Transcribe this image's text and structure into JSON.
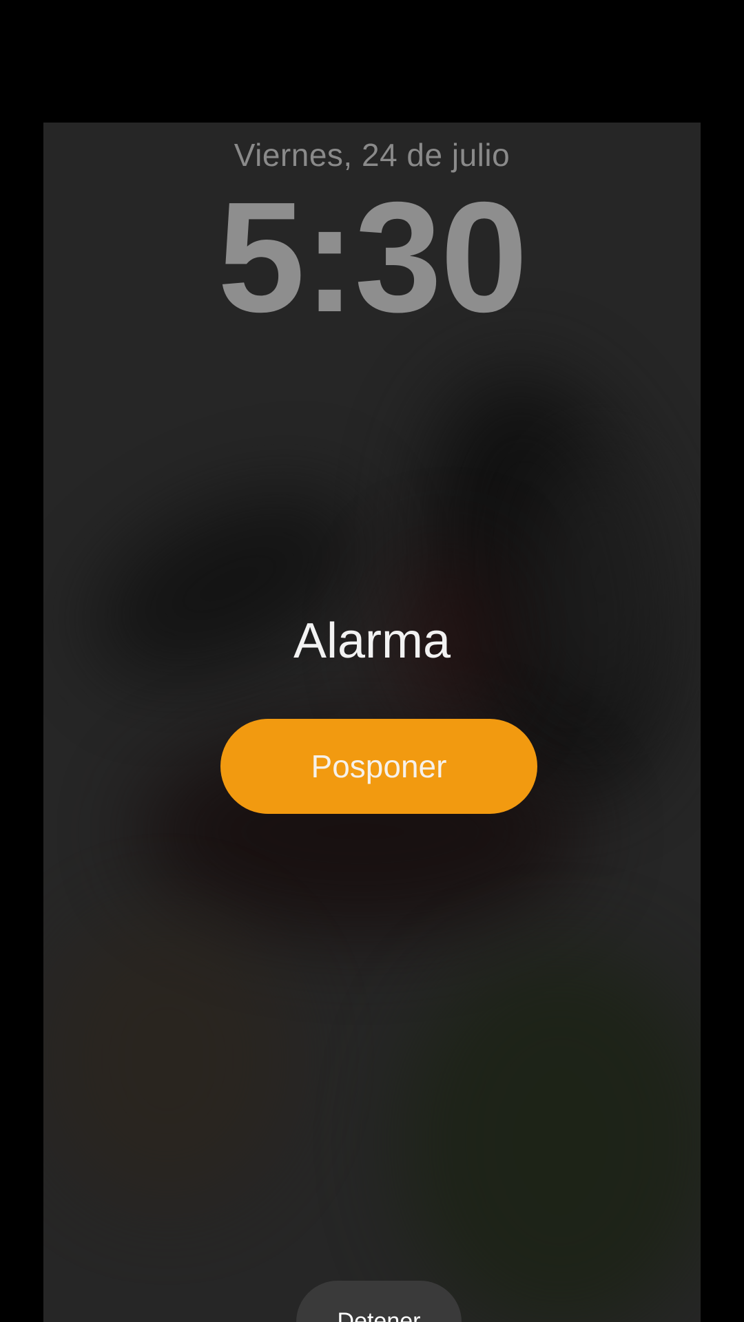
{
  "lock_screen": {
    "date": "Viernes, 24 de julio",
    "time": "5:30"
  },
  "alarm": {
    "label": "Alarma",
    "snooze_label": "Posponer",
    "stop_label": "Detener"
  },
  "colors": {
    "snooze_button": "#f29a10",
    "background": "#000000"
  }
}
